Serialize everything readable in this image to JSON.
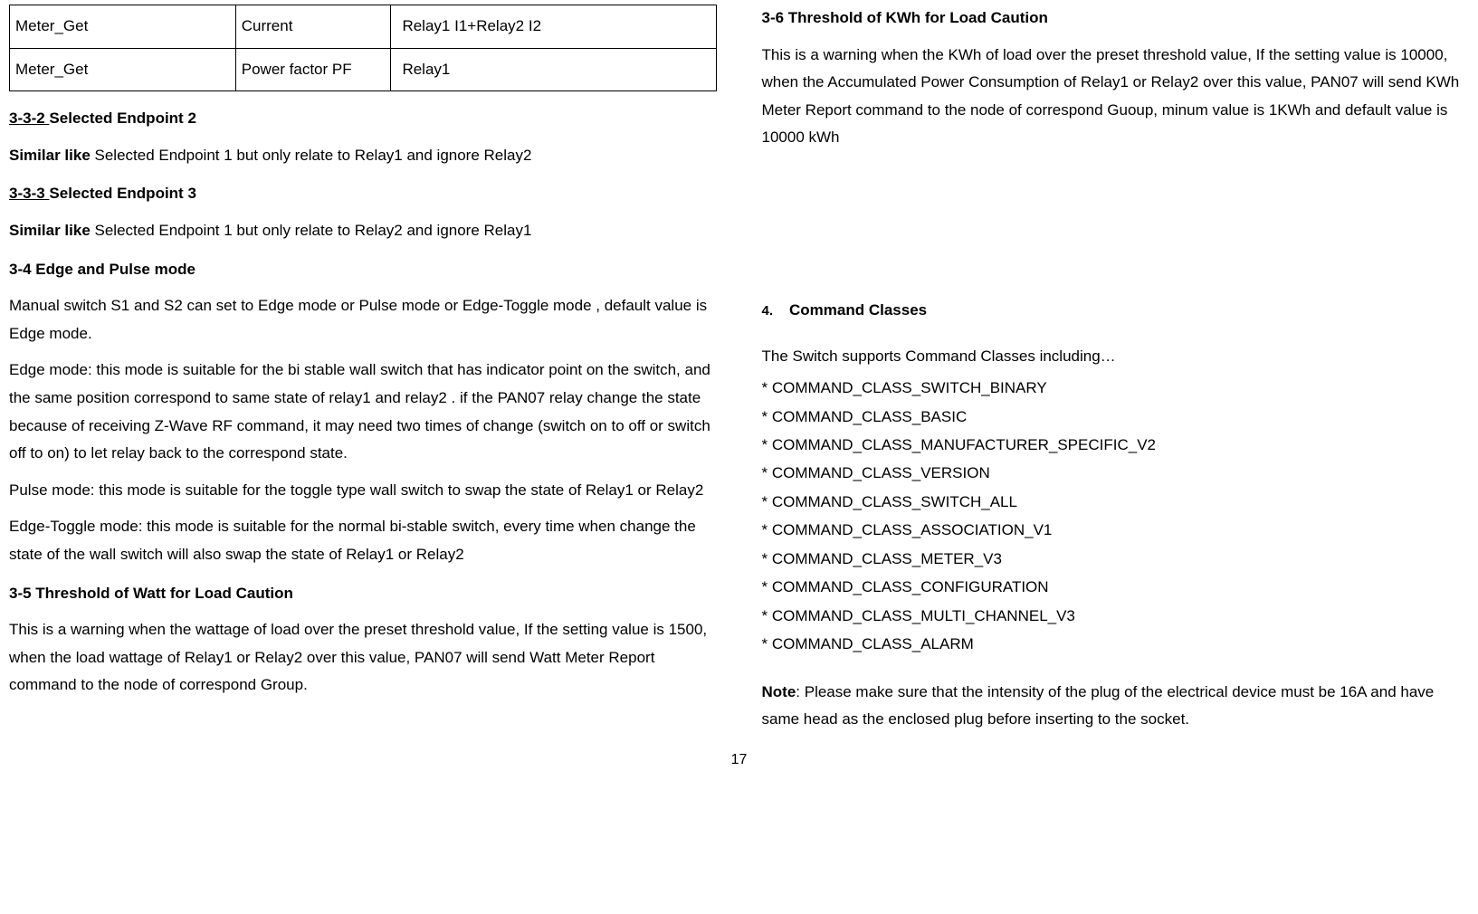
{
  "table": {
    "row1": {
      "c1": "Meter_Get",
      "c2": "Current",
      "c3": "Relay1 I1+Relay2 I2"
    },
    "row2": {
      "c1": "Meter_Get",
      "c2": "Power factor PF",
      "c3": "Relay1"
    }
  },
  "left": {
    "h332_u": "3-3-2 ",
    "h332_rest": "Selected Endpoint 2",
    "p332_b": "Similar like",
    "p332_rest": " Selected Endpoint 1 but only relate to Relay1 and ignore Relay2",
    "h333_u": "3-3-3 ",
    "h333_rest": "Selected Endpoint 3",
    "p333_b": "Similar like",
    "p333_rest": " Selected Endpoint 1 but only relate to Relay2 and ignore Relay1",
    "h34": "3-4 Edge and Pulse mode",
    "p34a": "Manual switch S1 and S2 can set to Edge mode or Pulse mode or Edge-Toggle mode , default value is Edge mode.",
    "p34b": "Edge mode: this mode is suitable for the bi stable wall switch that has indicator point on the switch, and the same position correspond to same state of relay1 and relay2 . if the PAN07 relay change the state because of receiving Z-Wave RF command, it may need two times of change (switch on to off  or  switch off to on) to let relay back to the correspond state.",
    "p34c": "Pulse mode: this mode is suitable for the toggle type wall switch to swap the state of Relay1 or Relay2",
    "p34d": "Edge-Toggle mode: this mode is suitable for the normal bi-stable switch, every time when change the state of the wall switch will also swap the state of Relay1 or Relay2",
    "h35": "3-5 Threshold of Watt for Load Caution",
    "p35": "This is a warning when the wattage of load over the preset threshold value, If  the setting value is 1500, when the load wattage of Relay1 or Relay2 over this value, PAN07 will send Watt Meter Report command to the node of correspond Group."
  },
  "right": {
    "h36": "3-6 Threshold of KWh for Load Caution",
    "p36": "This is a warning when the KWh of load over the preset threshold value, If  the setting value is 10000, when the Accumulated Power Consumption of Relay1 or Relay2 over this value, PAN07 will send KWh Meter Report command to the node of correspond Guoup, minum value is 1KWh and default value is 10000 kWh",
    "s4num": "4.",
    "s4title": "Command Classes",
    "cmdintro": "The Switch supports Command Classes including…",
    "cmds": [
      "* COMMAND_CLASS_SWITCH_BINARY",
      "* COMMAND_CLASS_BASIC",
      "* COMMAND_CLASS_MANUFACTURER_SPECIFIC_V2",
      "* COMMAND_CLASS_VERSION",
      "* COMMAND_CLASS_SWITCH_ALL",
      "* COMMAND_CLASS_ASSOCIATION_V1",
      "* COMMAND_CLASS_METER_V3",
      "* COMMAND_CLASS_CONFIGURATION",
      "* COMMAND_CLASS_MULTI_CHANNEL_V3",
      "* COMMAND_CLASS_ALARM"
    ],
    "note_b": "Note",
    "note_rest": ": Please make sure that the intensity of the plug of the electrical device must be 16A and have same head as the enclosed plug before inserting to the socket."
  },
  "page": "17"
}
